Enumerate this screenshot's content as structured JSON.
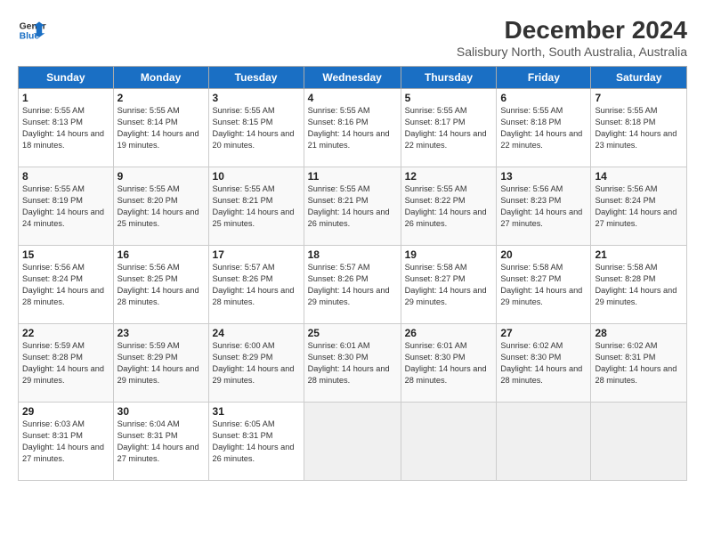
{
  "logo": {
    "line1": "General",
    "line2": "Blue"
  },
  "title": "December 2024",
  "subtitle": "Salisbury North, South Australia, Australia",
  "days_of_week": [
    "Sunday",
    "Monday",
    "Tuesday",
    "Wednesday",
    "Thursday",
    "Friday",
    "Saturday"
  ],
  "weeks": [
    [
      {
        "day": "1",
        "sunrise": "5:55 AM",
        "sunset": "8:13 PM",
        "daylight": "14 hours and 18 minutes."
      },
      {
        "day": "2",
        "sunrise": "5:55 AM",
        "sunset": "8:14 PM",
        "daylight": "14 hours and 19 minutes."
      },
      {
        "day": "3",
        "sunrise": "5:55 AM",
        "sunset": "8:15 PM",
        "daylight": "14 hours and 20 minutes."
      },
      {
        "day": "4",
        "sunrise": "5:55 AM",
        "sunset": "8:16 PM",
        "daylight": "14 hours and 21 minutes."
      },
      {
        "day": "5",
        "sunrise": "5:55 AM",
        "sunset": "8:17 PM",
        "daylight": "14 hours and 22 minutes."
      },
      {
        "day": "6",
        "sunrise": "5:55 AM",
        "sunset": "8:18 PM",
        "daylight": "14 hours and 22 minutes."
      },
      {
        "day": "7",
        "sunrise": "5:55 AM",
        "sunset": "8:18 PM",
        "daylight": "14 hours and 23 minutes."
      }
    ],
    [
      {
        "day": "8",
        "sunrise": "5:55 AM",
        "sunset": "8:19 PM",
        "daylight": "14 hours and 24 minutes."
      },
      {
        "day": "9",
        "sunrise": "5:55 AM",
        "sunset": "8:20 PM",
        "daylight": "14 hours and 25 minutes."
      },
      {
        "day": "10",
        "sunrise": "5:55 AM",
        "sunset": "8:21 PM",
        "daylight": "14 hours and 25 minutes."
      },
      {
        "day": "11",
        "sunrise": "5:55 AM",
        "sunset": "8:21 PM",
        "daylight": "14 hours and 26 minutes."
      },
      {
        "day": "12",
        "sunrise": "5:55 AM",
        "sunset": "8:22 PM",
        "daylight": "14 hours and 26 minutes."
      },
      {
        "day": "13",
        "sunrise": "5:56 AM",
        "sunset": "8:23 PM",
        "daylight": "14 hours and 27 minutes."
      },
      {
        "day": "14",
        "sunrise": "5:56 AM",
        "sunset": "8:24 PM",
        "daylight": "14 hours and 27 minutes."
      }
    ],
    [
      {
        "day": "15",
        "sunrise": "5:56 AM",
        "sunset": "8:24 PM",
        "daylight": "14 hours and 28 minutes."
      },
      {
        "day": "16",
        "sunrise": "5:56 AM",
        "sunset": "8:25 PM",
        "daylight": "14 hours and 28 minutes."
      },
      {
        "day": "17",
        "sunrise": "5:57 AM",
        "sunset": "8:26 PM",
        "daylight": "14 hours and 28 minutes."
      },
      {
        "day": "18",
        "sunrise": "5:57 AM",
        "sunset": "8:26 PM",
        "daylight": "14 hours and 29 minutes."
      },
      {
        "day": "19",
        "sunrise": "5:58 AM",
        "sunset": "8:27 PM",
        "daylight": "14 hours and 29 minutes."
      },
      {
        "day": "20",
        "sunrise": "5:58 AM",
        "sunset": "8:27 PM",
        "daylight": "14 hours and 29 minutes."
      },
      {
        "day": "21",
        "sunrise": "5:58 AM",
        "sunset": "8:28 PM",
        "daylight": "14 hours and 29 minutes."
      }
    ],
    [
      {
        "day": "22",
        "sunrise": "5:59 AM",
        "sunset": "8:28 PM",
        "daylight": "14 hours and 29 minutes."
      },
      {
        "day": "23",
        "sunrise": "5:59 AM",
        "sunset": "8:29 PM",
        "daylight": "14 hours and 29 minutes."
      },
      {
        "day": "24",
        "sunrise": "6:00 AM",
        "sunset": "8:29 PM",
        "daylight": "14 hours and 29 minutes."
      },
      {
        "day": "25",
        "sunrise": "6:01 AM",
        "sunset": "8:30 PM",
        "daylight": "14 hours and 28 minutes."
      },
      {
        "day": "26",
        "sunrise": "6:01 AM",
        "sunset": "8:30 PM",
        "daylight": "14 hours and 28 minutes."
      },
      {
        "day": "27",
        "sunrise": "6:02 AM",
        "sunset": "8:30 PM",
        "daylight": "14 hours and 28 minutes."
      },
      {
        "day": "28",
        "sunrise": "6:02 AM",
        "sunset": "8:31 PM",
        "daylight": "14 hours and 28 minutes."
      }
    ],
    [
      {
        "day": "29",
        "sunrise": "6:03 AM",
        "sunset": "8:31 PM",
        "daylight": "14 hours and 27 minutes."
      },
      {
        "day": "30",
        "sunrise": "6:04 AM",
        "sunset": "8:31 PM",
        "daylight": "14 hours and 27 minutes."
      },
      {
        "day": "31",
        "sunrise": "6:05 AM",
        "sunset": "8:31 PM",
        "daylight": "14 hours and 26 minutes."
      },
      null,
      null,
      null,
      null
    ]
  ]
}
